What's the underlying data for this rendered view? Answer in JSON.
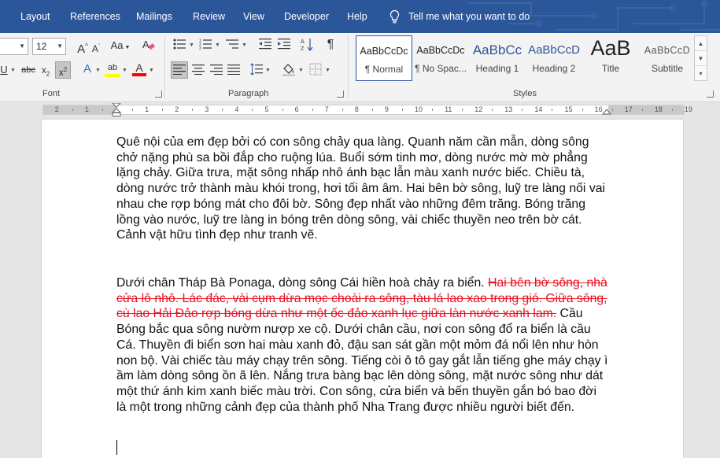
{
  "menu": {
    "tabs": [
      "Layout",
      "References",
      "Mailings",
      "Review",
      "View",
      "Developer",
      "Help"
    ],
    "tell_me": "Tell me what you want to do"
  },
  "ribbon": {
    "font": {
      "group_label": "Font",
      "font_size": "12"
    },
    "paragraph": {
      "group_label": "Paragraph"
    },
    "styles": {
      "group_label": "Styles",
      "items": [
        {
          "preview": "AaBbCcDc",
          "name": "¶ Normal"
        },
        {
          "preview": "AaBbCcDc",
          "name": "¶ No Spac..."
        },
        {
          "preview": "AaBbCc",
          "name": "Heading 1"
        },
        {
          "preview": "AaBbCcD",
          "name": "Heading 2"
        },
        {
          "preview": "AaB",
          "name": "Title"
        },
        {
          "preview": "AaBbCcD",
          "name": "Subtitle"
        }
      ]
    }
  },
  "ruler": {
    "numbers": [
      "2",
      "1",
      "1",
      "2",
      "3",
      "4",
      "5",
      "6",
      "7",
      "8",
      "9",
      "10",
      "11",
      "12",
      "13",
      "14",
      "15",
      "16",
      "17",
      "18",
      "19"
    ]
  },
  "document": {
    "para1": "Quê nội của em đẹp bởi có con sông chảy qua làng. Quanh năm cần mẫn, dòng sông chở nặng phù sa bồi đắp cho ruộng lúa. Buổi sớm tinh mơ, dòng nước mờ mờ phẳng lặng chảy. Giữa trưa, mặt sông nhấp nhô ánh bạc lẫn màu xanh nước biếc. Chiều tà, dòng nước trở thành màu khói trong, hơi tối âm âm. Hai bên bờ sông, luỹ tre làng nối vai nhau che rợp bóng mát cho đôi bờ. Sông đẹp nhất vào những đêm trăng. Bóng trăng lồng vào nước, luỹ tre làng in bóng trên dòng sông, vài chiếc thuyền neo trên bờ cát. Cảnh vật hữu tình đẹp như tranh vẽ.",
    "para2_start": "Dưới chân Tháp Bà Ponaga, dòng sông Cái hiền hoà chảy ra biển. ",
    "para2_deleted": "Hai bên bờ sông, nhà cửa lô nhô. Lác đác, vài cụm dừa mọc choài ra sông, tàu lá lao xao trong gió. Giữa sông, cù lao Hải Đảo rợp bóng dừa như một ốc đảo xanh lục giữa làn nước xanh lam.",
    "para2_end": " Cầu Bóng bắc qua sông nườm nượp xe cộ. Dưới chân cầu, nơi con sông đổ ra biển là cầu Cá. Thuyền đi biển sơn hai màu xanh đỏ, đậu san sát gần một mỏm đá nổi lên như hòn non bộ. Vài chiếc tàu máy chạy trên sông. Tiếng còi ô tô gay gắt lẫn tiếng ghe máy chạy ì ầm làm dòng sông ồn ã lên. Nắng trưa bàng bạc lên dòng sông, mặt nước sông như dát một thứ ánh kim xanh biếc màu trời. Con sông, cửa biển và bến thuyền gắn bó bao đời là một trong những cảnh đẹp của thành phố Nha Trang được nhiều người biết đến."
  },
  "colors": {
    "menu_bg": "#2b579a",
    "deleted_text": "#e81123",
    "highlight": "#ffff00",
    "font_color": "#ff0000"
  }
}
